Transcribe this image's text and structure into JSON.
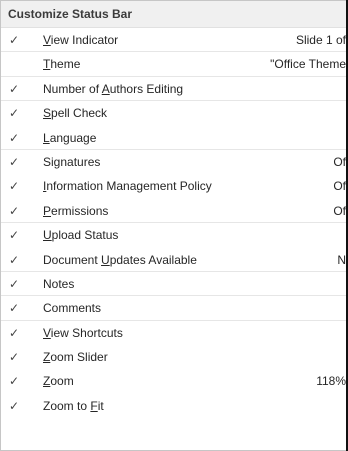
{
  "menu": {
    "title": "Customize Status Bar",
    "check_glyph": "✓",
    "items": [
      {
        "pre": "",
        "acc": "V",
        "post": "iew Indicator",
        "value": "Slide 1 of",
        "checked": true,
        "sep": true
      },
      {
        "pre": "",
        "acc": "T",
        "post": "heme",
        "value": "\"Office Theme",
        "checked": false,
        "sep": true
      },
      {
        "pre": "Number of ",
        "acc": "A",
        "post": "uthors Editing",
        "value": "",
        "checked": true,
        "sep": true
      },
      {
        "pre": "",
        "acc": "S",
        "post": "pell Check",
        "value": "",
        "checked": true,
        "sep": false
      },
      {
        "pre": "",
        "acc": "L",
        "post": "anguage",
        "value": "",
        "checked": true,
        "sep": true
      },
      {
        "pre": "Si",
        "acc": "g",
        "post": "natures",
        "value": "Of",
        "checked": true,
        "sep": false
      },
      {
        "pre": "",
        "acc": "I",
        "post": "nformation Management Policy",
        "value": "Of",
        "checked": true,
        "sep": false
      },
      {
        "pre": "",
        "acc": "P",
        "post": "ermissions",
        "value": "Of",
        "checked": true,
        "sep": true
      },
      {
        "pre": "",
        "acc": "U",
        "post": "pload Status",
        "value": "",
        "checked": true,
        "sep": false
      },
      {
        "pre": "Document ",
        "acc": "U",
        "post": "pdates Available",
        "value": "N",
        "checked": true,
        "sep": true
      },
      {
        "pre": "Notes",
        "acc": "",
        "post": "",
        "value": "",
        "checked": true,
        "sep": true
      },
      {
        "pre": "Comments",
        "acc": "",
        "post": "",
        "value": "",
        "checked": true,
        "sep": true
      },
      {
        "pre": "",
        "acc": "V",
        "post": "iew Shortcuts",
        "value": "",
        "checked": true,
        "sep": false
      },
      {
        "pre": "",
        "acc": "Z",
        "post": "oom Slider",
        "value": "",
        "checked": true,
        "sep": false
      },
      {
        "pre": "",
        "acc": "Z",
        "post": "oom",
        "value": "118%",
        "checked": true,
        "sep": false
      },
      {
        "pre": "Zoom to ",
        "acc": "F",
        "post": "it",
        "value": "",
        "checked": true,
        "sep": false
      }
    ]
  }
}
